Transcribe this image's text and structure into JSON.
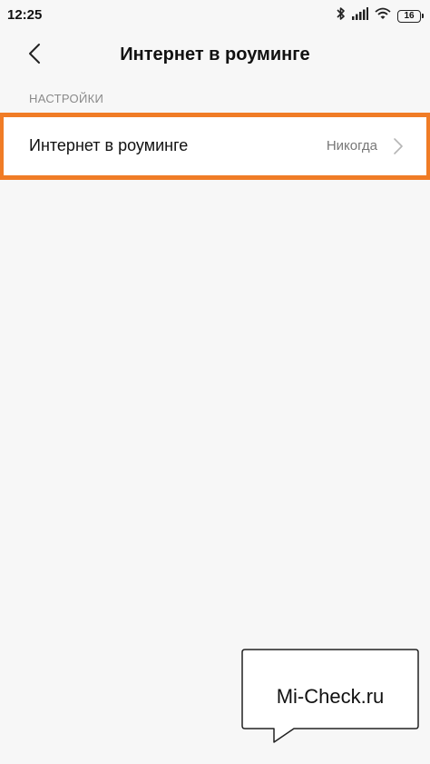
{
  "status_bar": {
    "time": "12:25",
    "battery": "16",
    "icons": [
      "bluetooth-icon",
      "signal-icon",
      "wifi-icon",
      "battery-icon"
    ]
  },
  "header": {
    "back_icon": "chevron-left-icon",
    "title": "Интернет в роуминге"
  },
  "settings": {
    "section_label": "НАСТРОЙКИ",
    "row": {
      "label": "Интернет в роуминге",
      "value": "Никогда",
      "chevron_icon": "chevron-right-icon"
    }
  },
  "colors": {
    "highlight": "#f07c26",
    "background": "#f7f7f7"
  },
  "watermark": {
    "text": "Mi-Check.ru"
  }
}
